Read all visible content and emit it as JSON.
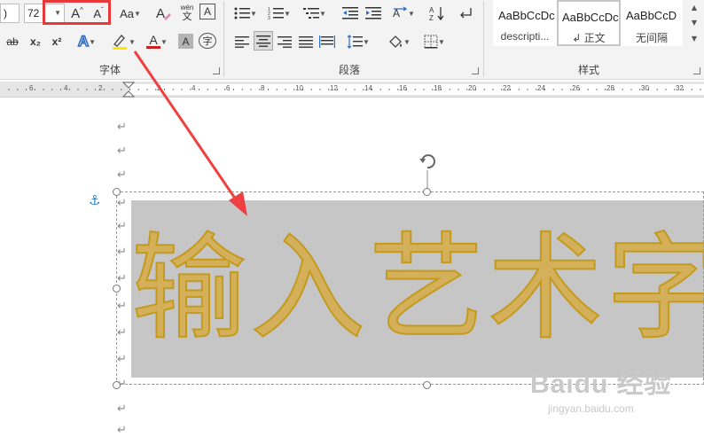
{
  "ribbon": {
    "font_size_left_value": ")",
    "font_size_value": "72",
    "grow_font_glyph": "A",
    "shrink_font_glyph": "A",
    "change_case_label": "Aa",
    "phonetic_top": "wén",
    "phonetic_bottom": "文",
    "char_border_label": "A",
    "strike_label": "ab",
    "subscript_label": "x₂",
    "superscript_label": "x²",
    "text_effect_label": "A",
    "font_color_label": "A",
    "char_shading_label": "A",
    "enclose_label": "字",
    "highlight_color": "#ffe600",
    "font_color": "#cc1f1f",
    "groups": {
      "font": "字体",
      "paragraph": "段落",
      "styles": "样式"
    },
    "styles": [
      {
        "sample": "AaBbCcDc",
        "name": "descripti..."
      },
      {
        "sample": "AaBbCcDc",
        "name": "↲ 正文"
      },
      {
        "sample": "AaBbCcD",
        "name": "无间隔"
      }
    ]
  },
  "ruler": {
    "numbers": [
      "6",
      "4",
      "2",
      "2",
      "4",
      "6",
      "8",
      "10",
      "12",
      "14",
      "16",
      "18",
      "20",
      "22",
      "24",
      "26",
      "28",
      "30",
      "32"
    ]
  },
  "document": {
    "paragraph_mark": "↵",
    "wordart_text": "输入艺术字"
  },
  "watermark": {
    "line1": "Baidu 经验",
    "line2": "jingyan.baidu.com"
  },
  "colors": {
    "annotation_red": "#e63a3a",
    "wordart_fill": "#d4b05a",
    "wordart_outline": "#c49a1c",
    "textbox_fill": "#c6c6c6"
  }
}
